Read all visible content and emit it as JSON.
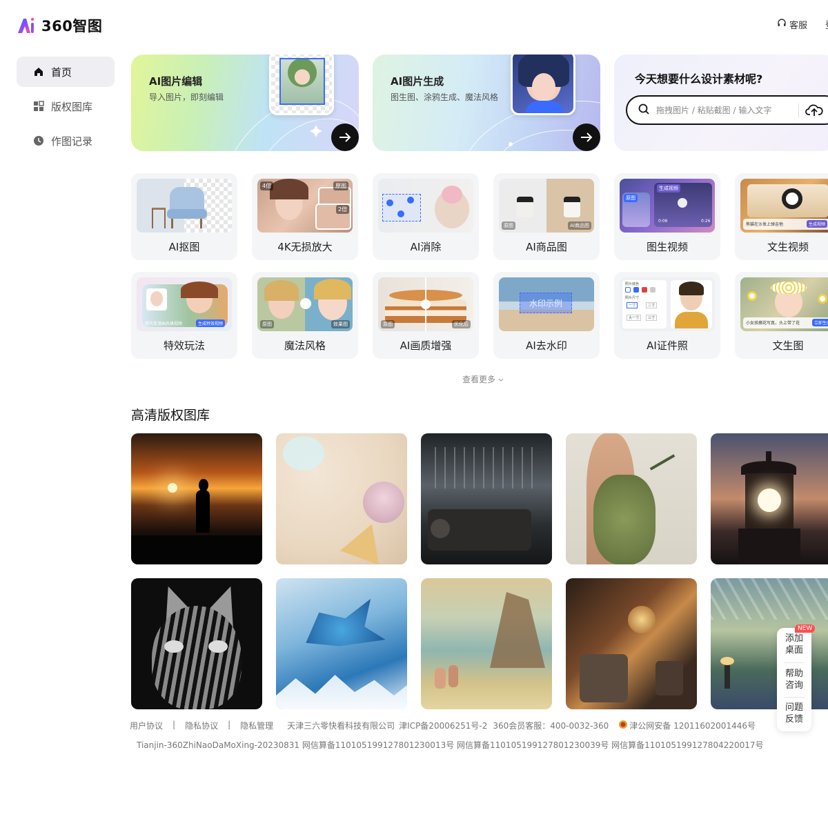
{
  "header": {
    "brand": "360智图",
    "service_label": "客服",
    "login_label": "登"
  },
  "sidebar": {
    "items": [
      {
        "label": "首页",
        "icon": "home-icon"
      },
      {
        "label": "版权图库",
        "icon": "grid-icon"
      },
      {
        "label": "作图记录",
        "icon": "clock-icon"
      }
    ]
  },
  "hero": {
    "edit": {
      "title": "AI图片编辑",
      "subtitle": "导入图片，即刻编辑"
    },
    "generate": {
      "title": "AI图片生成",
      "subtitle": "图生图、涂鸦生成、魔法风格"
    },
    "search": {
      "title": "今天想要什么设计素材呢?",
      "placeholder": "拖拽图片 / 粘贴截图 / 输入文字"
    }
  },
  "tools": [
    {
      "label": "AI抠图"
    },
    {
      "label": "4K无损放大",
      "badges": [
        "4倍",
        "原图",
        "2倍"
      ]
    },
    {
      "label": "AI消除"
    },
    {
      "label": "AI商品图",
      "badges": [
        "原图",
        "AI商品图"
      ]
    },
    {
      "label": "图生视频",
      "badges": [
        "原图",
        "生成视频",
        "0:06",
        "0:26"
      ]
    },
    {
      "label": "文生视频",
      "badges": [
        "熊猫在沙发上弹吉他",
        "生成视频"
      ]
    },
    {
      "label": "特效玩法",
      "badges": [
        "照片变漫画风格视频",
        "生成特效视频"
      ]
    },
    {
      "label": "魔法风格",
      "badges": [
        "原图",
        "效果图"
      ]
    },
    {
      "label": "AI画质增强",
      "badges": [
        "原图",
        "优化后"
      ]
    },
    {
      "label": "AI去水印",
      "badges": [
        "水印示例"
      ]
    },
    {
      "label": "AI证件照",
      "badges": [
        "照片底色",
        "照片尺寸",
        "一寸",
        "二寸",
        "大一寸",
        "三寸"
      ]
    },
    {
      "label": "文生图",
      "badges": [
        "小女孩摘花写真，头上带了花",
        "立即生成"
      ]
    }
  ],
  "more_label": "查看更多",
  "gallery": {
    "title": "高清版权图库",
    "photos": [
      "sunset-silhouette",
      "beach-shells",
      "steampunk-train",
      "nature-woman",
      "lighthouse-lamp",
      "cat-vector",
      "ice-dragon",
      "impressionist-coast",
      "robot-battle",
      "station-painting"
    ]
  },
  "footer": {
    "line1": [
      "用户协议",
      "|",
      "隐私协议",
      "|",
      "隐私管理",
      "天津三六零快看科技有限公司",
      "津ICP备20006251号-2",
      "360会员客服：400-0032-360",
      "津公网安备 12011602001446号"
    ],
    "line2": "Tianjin-360ZhiNaoDaMoXing-20230831 网信算备110105199127801230013号 网信算备110105199127801230039号 网信算备110105199127804220017号"
  },
  "floating": {
    "badge": "NEW",
    "items": [
      "添加\n桌面",
      "帮助\n咨询",
      "问题\n反馈"
    ]
  },
  "colors": {
    "accent": "#111111",
    "nav_active_bg": "#efeff3",
    "tool_bg": "#f4f5f7"
  }
}
